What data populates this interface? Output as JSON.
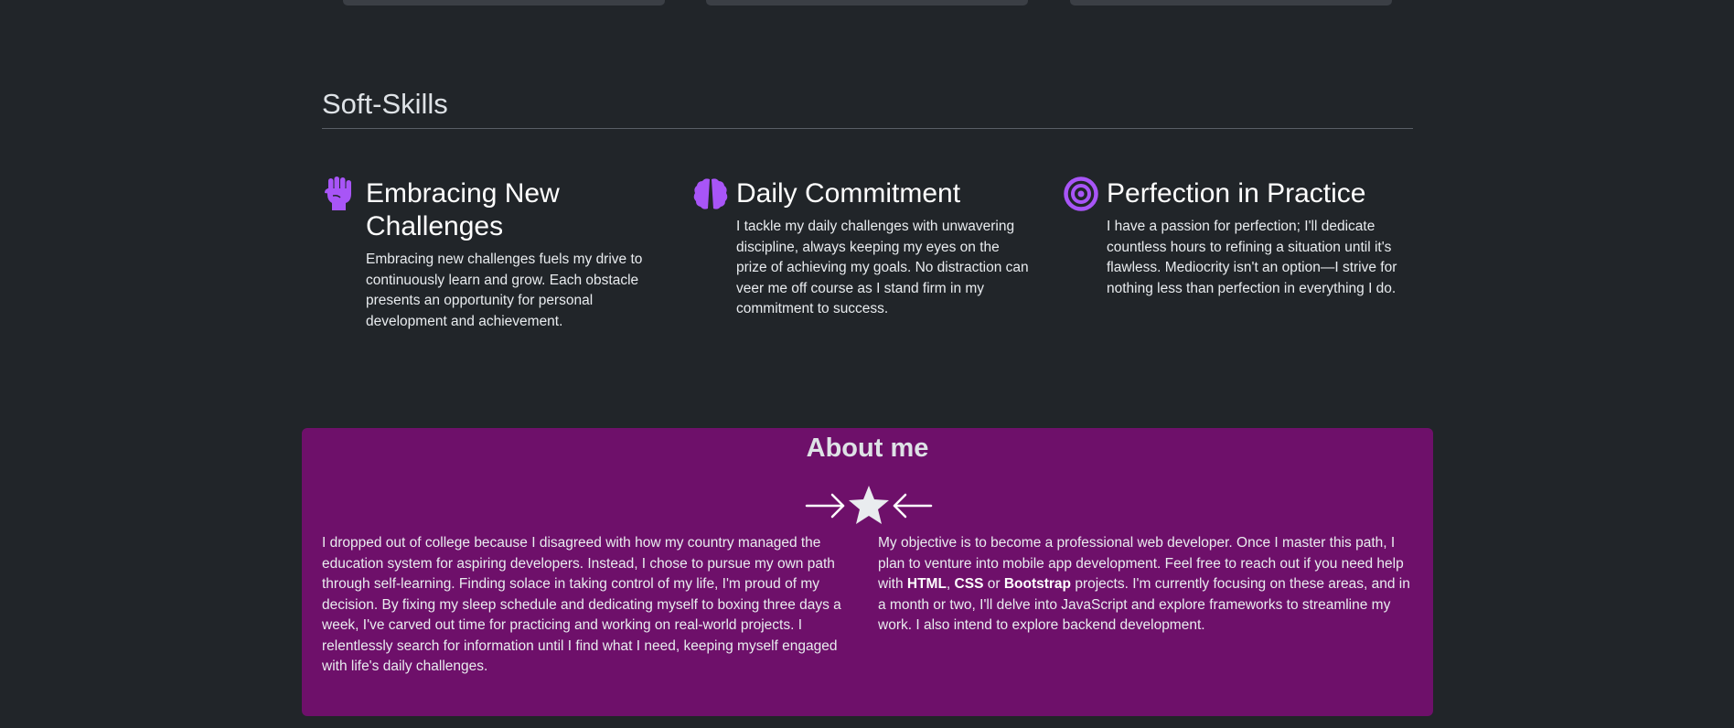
{
  "soft_skills": {
    "title": "Soft-Skills",
    "items": [
      {
        "icon": "raised-fist-icon",
        "title_line1": "Embracing New",
        "title_line2": "Challenges",
        "description": "Embracing new challenges fuels my drive to continuously learn and grow. Each obstacle presents an opportunity for personal development and achievement."
      },
      {
        "icon": "brain-icon",
        "title_line1": "Daily Commitment",
        "description": "I tackle my daily challenges with unwavering discipline, always keeping my eyes on the prize of achieving my goals. No distraction can veer me off course as I stand firm in my commitment to success."
      },
      {
        "icon": "bullseye-icon",
        "title_line1": "Perfection in Practice",
        "description": "I have a passion for perfection; I'll dedicate countless hours to refining a situation until it's flawless. Mediocrity isn't an option—I strive for nothing less than perfection in everything I do."
      }
    ]
  },
  "about": {
    "title": "About me",
    "divider_icon": "star-icon",
    "left_text": "I dropped out of college because I disagreed with how my country managed the education system for aspiring developers. Instead, I chose to pursue my own path through self-learning. Finding solace in taking control of my life, I'm proud of my decision. By fixing my sleep schedule and dedicating myself to boxing three days a week, I've carved out time for practicing and working on real-world projects. I relentlessly search for information until I find what I need, keeping myself engaged with life's daily challenges.",
    "right_text_part1": "My objective is to become a professional web developer. Once I master this path, I plan to venture into mobile app development. Feel free to reach out if you need help with ",
    "html_label": "HTML",
    "comma": ", ",
    "css_label": "CSS",
    "or_text": " or ",
    "bootstrap_label": "Bootstrap",
    "right_text_part2": " projects. I'm currently focusing on these areas, and in a month or two, I'll delve into JavaScript and explore frameworks to streamline my work. I also intend to explore backend development."
  },
  "colors": {
    "background": "#212529",
    "about_background": "#6e106a",
    "icon_accent": "#a855f7"
  }
}
